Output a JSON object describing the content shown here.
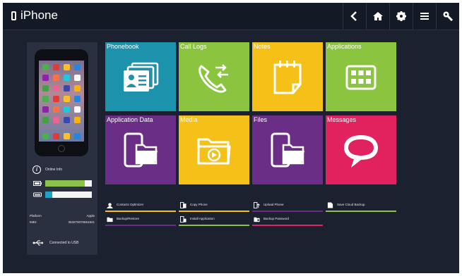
{
  "app_title": "iPhone",
  "toolbar": {
    "back_icon": "back-arrow-icon",
    "home_icon": "home-icon",
    "settings_icon": "gear-icon",
    "menu_icon": "menu-icon",
    "tools_icon": "wrench-icon"
  },
  "device": {
    "online_info": "Online Info",
    "platform_label": "Platform",
    "platform_value": "Apple",
    "imei_label": "IMEI:",
    "imei_value": "353270070651841",
    "connection": "Connected to USB",
    "battery_level": 0.85,
    "storage_level": 0.15,
    "battery_color": "#8bc34a",
    "storage_color": "#1ea3c7"
  },
  "tiles": [
    {
      "label": "Phonebook",
      "color": "#1d92ac",
      "icon": "contacts-cards-icon"
    },
    {
      "label": "Call Logs",
      "color": "#8bc53f",
      "icon": "phone-call-icon"
    },
    {
      "label": "Notes",
      "color": "#f5c118",
      "icon": "notepad-icon"
    },
    {
      "label": "Applications",
      "color": "#8bc53f",
      "icon": "app-grid-icon"
    },
    {
      "label": "Application Data",
      "color": "#6a2e87",
      "icon": "phone-folder-icon"
    },
    {
      "label": "Media",
      "color": "#f5c118",
      "icon": "media-folder-icon"
    },
    {
      "label": "Files",
      "color": "#6a2e87",
      "icon": "phone-folder-icon"
    },
    {
      "label": "Messages",
      "color": "#e2225f",
      "icon": "chat-bubble-icon"
    }
  ],
  "actions": [
    {
      "label": "Contacts Optimizer",
      "color": "#f5c118"
    },
    {
      "label": "Copy Phone",
      "color": "#f5c118"
    },
    {
      "label": "Upload Phone",
      "color": "#6a2e87"
    },
    {
      "label": "Save Cloud Backup",
      "color": "#8bc53f"
    },
    {
      "label": "Backup/Restore",
      "color": "#6a2e87"
    },
    {
      "label": "Install Application",
      "color": "#8bc53f"
    },
    {
      "label": "Backup Password",
      "color": "#e2225f"
    }
  ]
}
